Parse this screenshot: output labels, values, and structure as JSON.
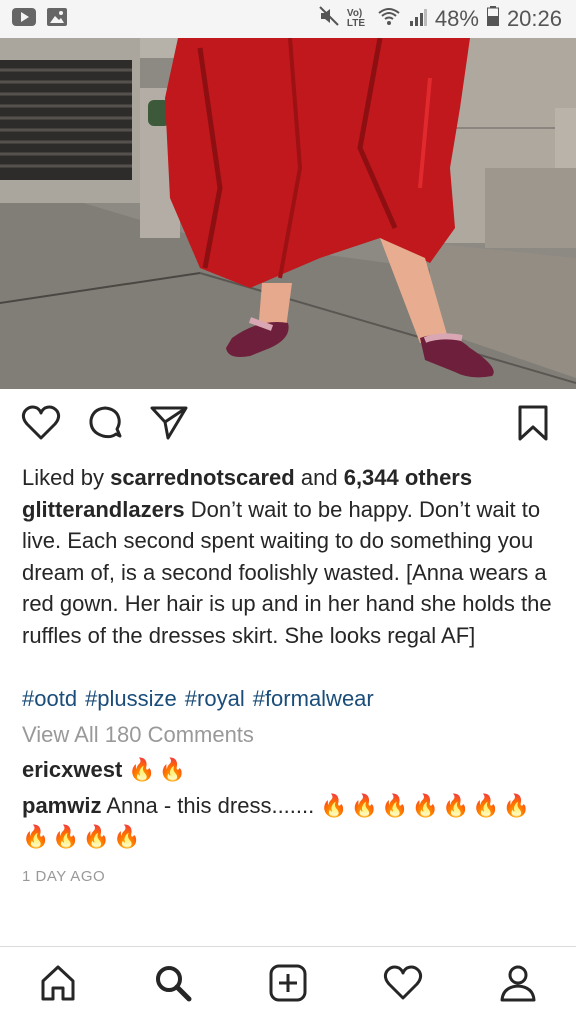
{
  "status_bar": {
    "icons_left": [
      "youtube-icon",
      "image-icon"
    ],
    "icons_right": [
      "mute-icon",
      "volte-icon",
      "wifi-icon",
      "signal-icon",
      "battery-icon"
    ],
    "volte_label": "Vo) LTE",
    "battery": "48%",
    "time": "20:26"
  },
  "post": {
    "likes": {
      "prefix": "Liked by",
      "user": "scarrednotscared",
      "middle": "and",
      "others": "6,344 others"
    },
    "caption": {
      "user": "glitterandlazers",
      "text": "Don’t wait to be happy. Don’t wait to live. Each second spent waiting to do something you dream of, is a second foolishly wasted. [Anna wears a red gown. Her hair is up and in her hand she holds the ruffles of the dresses skirt. She looks regal AF]"
    },
    "hashtags": [
      "#ootd",
      "#plussize",
      "#royal",
      "#formalwear"
    ],
    "view_all": "View All 180 Comments",
    "comments": [
      {
        "user": "ericxwest",
        "text": "",
        "emoji": "🔥🔥"
      },
      {
        "user": "pamwiz",
        "text": "Anna - this dress.......",
        "emoji": "🔥🔥🔥🔥🔥🔥🔥🔥🔥🔥🔥"
      }
    ],
    "time": "1 DAY AGO"
  },
  "colors": {
    "hashtag": "#1a4d7a",
    "muted": "#999999",
    "fire": "#e8561d",
    "dress": "#c0181c"
  },
  "nav_icons": [
    "home-icon",
    "search-icon",
    "add-post-icon",
    "activity-heart-icon",
    "profile-icon"
  ]
}
